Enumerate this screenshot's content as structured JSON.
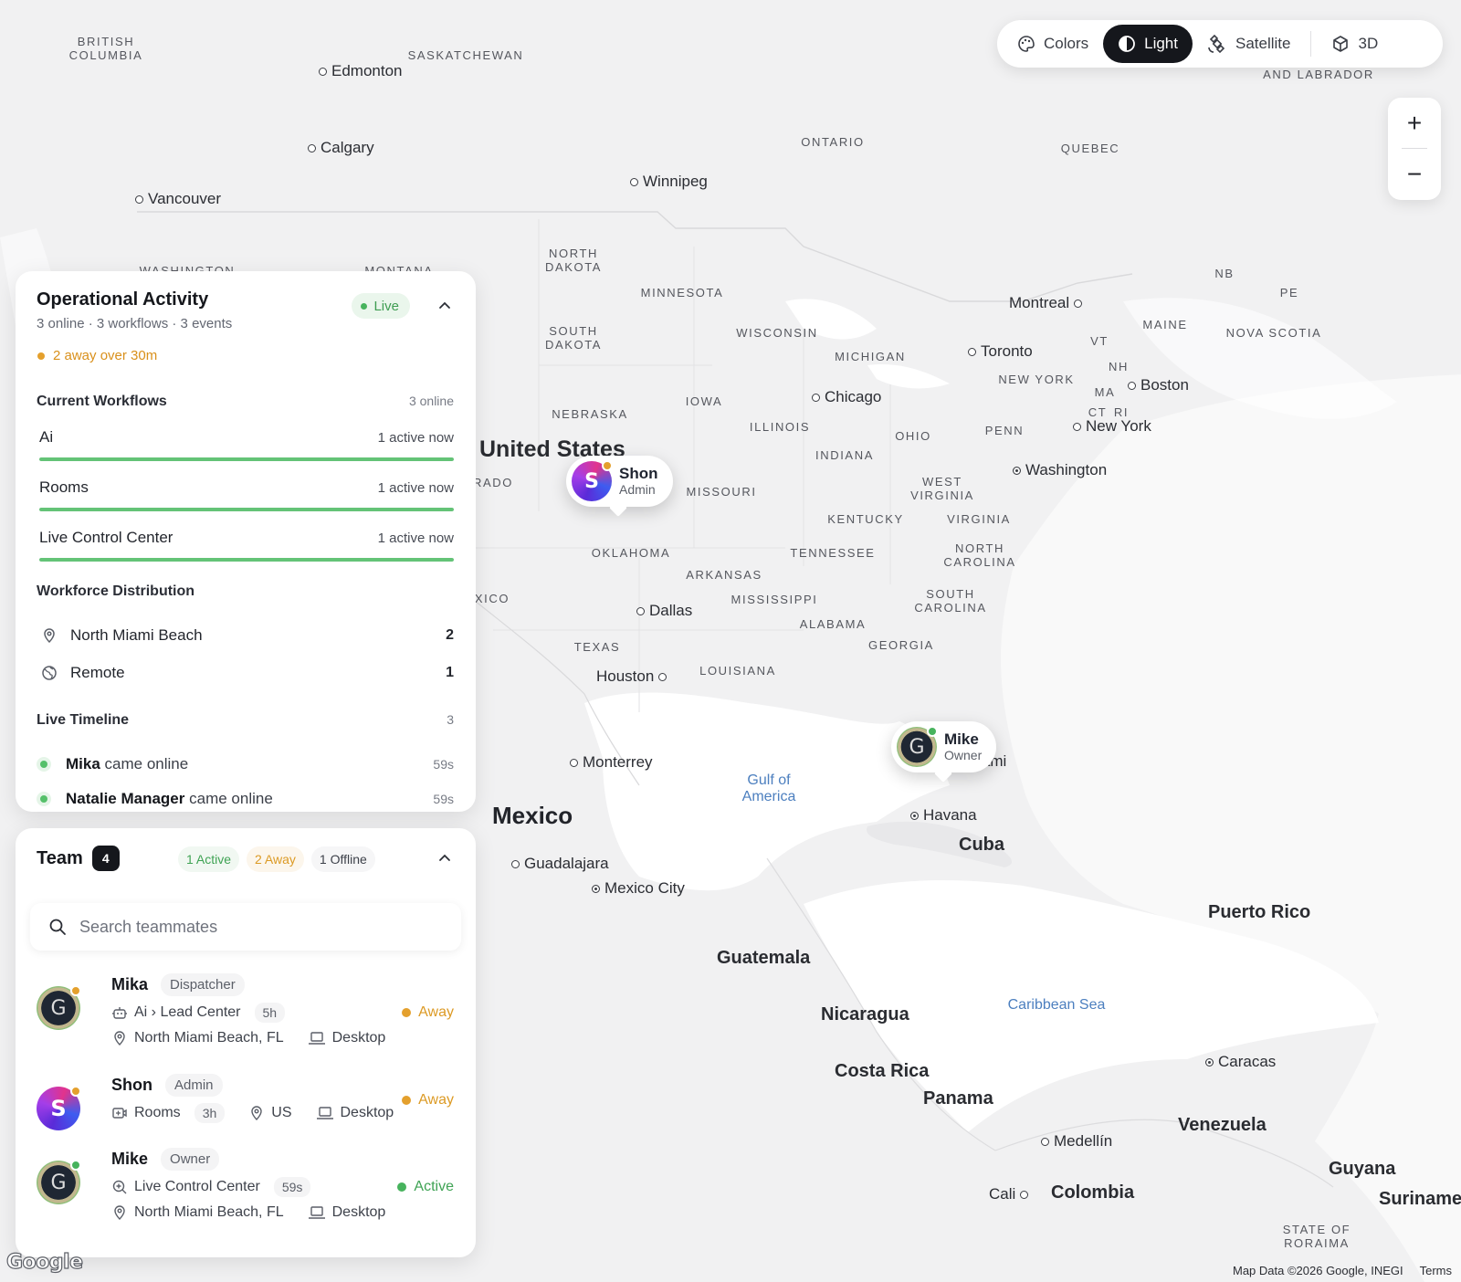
{
  "mapbar": {
    "colors": "Colors",
    "light": "Light",
    "satellite": "Satellite",
    "threed": "3D"
  },
  "zoom": {
    "in": "+",
    "out": "−"
  },
  "map": {
    "regions": [
      "BRITISH\nCOLUMBIA",
      "SASKATCHEWAN",
      "ONTARIO",
      "QUEBEC",
      "AND LABRADOR",
      "WASHINGTON",
      "MONTANA",
      "NORTH\nDAKOTA",
      "MINNESOTA",
      "SOUTH\nDAKOTA",
      "WISCONSIN",
      "MICHIGAN",
      "NEBRASKA",
      "IOWA",
      "ILLINOIS",
      "INDIANA",
      "OHIO",
      "PENN",
      "NEW YORK",
      "VT",
      "NH",
      "MAINE",
      "NB",
      "PE",
      "NOVA SCOTIA",
      "MA",
      "CT",
      "RI",
      "WEST\nVIRGINIA",
      "VIRGINIA",
      "KENTUCKY",
      "MISSOURI",
      "RADO",
      "OKLAHOMA",
      "TENNESSEE",
      "NORTH\nCAROLINA",
      "ARKANSAS",
      "MISSISSIPPI",
      "ALABAMA",
      "SOUTH\nCAROLINA",
      "GEORGIA",
      "TEXAS",
      "LOUISIANA",
      "XICO",
      "STATE OF\nRORAIMA"
    ],
    "cities": [
      "Edmonton",
      "Calgary",
      "Vancouver",
      "Winnipeg",
      "Montreal",
      "Toronto",
      "Boston",
      "Chicago",
      "New York",
      "Washington",
      "Dallas",
      "Houston",
      "Monterrey",
      "Miami",
      "Havana",
      "Guadalajara",
      "Mexico City",
      "Caracas",
      "Medellín",
      "Cali"
    ],
    "countries": [
      "United States",
      "Cuba",
      "Puerto Rico",
      "Guatemala",
      "Nicaragua",
      "Costa Rica",
      "Panama",
      "Venezuela",
      "Colombia",
      "Guyana",
      "Suriname"
    ],
    "bigcountry": "Mexico",
    "waters": [
      "Gulf of\nAmerica",
      "Caribbean Sea"
    ],
    "google": "Google",
    "attribution": "Map Data ©2026 Google, INEGI",
    "terms": "Terms"
  },
  "pins": [
    {
      "name": "Shon",
      "role": "Admin",
      "avatar": "S"
    },
    {
      "name": "Mike",
      "role": "Owner",
      "avatar": "G"
    }
  ],
  "ops": {
    "title": "Operational Activity",
    "subtitle": "3 online · 3 workflows · 3 events",
    "live": "Live",
    "away_note": "2 away over 30m",
    "workflows_title": "Current Workflows",
    "workflows_count": "3 online",
    "workflows": [
      {
        "name": "Ai",
        "status": "1 active now",
        "level": 1.0
      },
      {
        "name": "Rooms",
        "status": "1 active now",
        "level": 1.0
      },
      {
        "name": "Live Control Center",
        "status": "1 active now",
        "level": 1.0
      }
    ],
    "dist_title": "Workforce Distribution",
    "dist": [
      {
        "name": "North Miami Beach",
        "value": "2"
      },
      {
        "name": "Remote",
        "value": "1"
      }
    ],
    "timeline_title": "Live Timeline",
    "timeline_count": "3",
    "timeline": [
      {
        "who": "Mika",
        "what": " came online",
        "time": "59s"
      },
      {
        "who": "Natalie Manager",
        "what": " came online",
        "time": "59s"
      }
    ]
  },
  "team": {
    "title": "Team",
    "count": "4",
    "filters": {
      "active": "1 Active",
      "away": "2 Away",
      "offline": "1 Offline"
    },
    "search_placeholder": "Search teammates",
    "members": [
      {
        "name": "Mika",
        "role": "Dispatcher",
        "where": "Ai › Lead Center",
        "dur": "5h",
        "loc": "North Miami Beach, FL",
        "device": "Desktop",
        "status": "Away",
        "avatar": "G"
      },
      {
        "name": "Shon",
        "role": "Admin",
        "where": "Rooms",
        "dur": "3h",
        "loc": "US",
        "device": "Desktop",
        "status": "Away",
        "avatar": "S"
      },
      {
        "name": "Mike",
        "role": "Owner",
        "where": "Live Control Center",
        "dur": "59s",
        "loc": "North Miami Beach, FL",
        "device": "Desktop",
        "status": "Active",
        "avatar": "G"
      }
    ]
  },
  "colors": {
    "active": "#47b35d",
    "away": "#e4a02d",
    "dark": "#15171c"
  }
}
